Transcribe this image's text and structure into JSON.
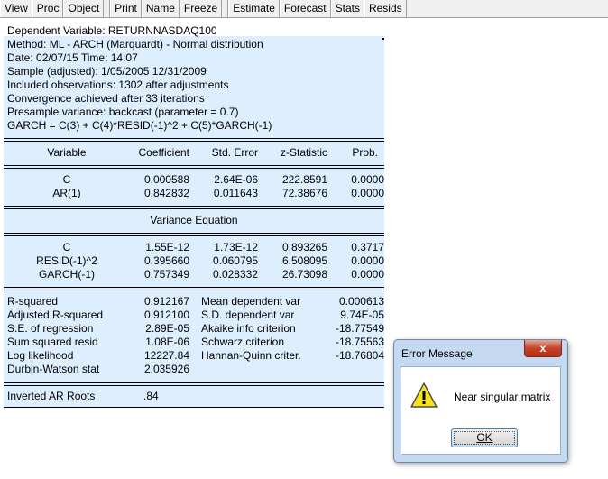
{
  "toolbar": {
    "group1": [
      "View",
      "Proc",
      "Object"
    ],
    "group2": [
      "Print",
      "Name",
      "Freeze"
    ],
    "group3": [
      "Estimate",
      "Forecast",
      "Stats",
      "Resids"
    ]
  },
  "header": [
    "Dependent Variable: RETURNNASDAQ100",
    "Method: ML - ARCH (Marquardt) - Normal distribution",
    "Date: 02/07/15   Time: 14:07",
    "Sample (adjusted): 1/05/2005 12/31/2009",
    "Included observations: 1302 after adjustments",
    "Convergence achieved after 33 iterations",
    "Presample variance: backcast (parameter = 0.7)",
    "GARCH = C(3) + C(4)*RESID(-1)^2 + C(5)*GARCH(-1)"
  ],
  "columns": [
    "Variable",
    "Coefficient",
    "Std. Error",
    "z-Statistic",
    "Prob."
  ],
  "mean_rows": [
    [
      "C",
      "0.000588",
      "2.64E-06",
      "222.8591",
      "0.0000"
    ],
    [
      "AR(1)",
      "0.842832",
      "0.011643",
      "72.38676",
      "0.0000"
    ]
  ],
  "variance_title": "Variance Equation",
  "variance_rows": [
    [
      "C",
      "1.55E-12",
      "1.73E-12",
      "0.893265",
      "0.3717"
    ],
    [
      "RESID(-1)^2",
      "0.395660",
      "0.060795",
      "6.508095",
      "0.0000"
    ],
    [
      "GARCH(-1)",
      "0.757349",
      "0.028332",
      "26.73098",
      "0.0000"
    ]
  ],
  "stats_rows": [
    [
      "R-squared",
      "0.912167",
      "Mean dependent var",
      "0.000613"
    ],
    [
      "Adjusted R-squared",
      "0.912100",
      "S.D. dependent var",
      "9.74E-05"
    ],
    [
      "S.E. of regression",
      "2.89E-05",
      "Akaike info criterion",
      "-18.77549"
    ],
    [
      "Sum squared resid",
      "1.08E-06",
      "Schwarz criterion",
      "-18.75563"
    ],
    [
      "Log likelihood",
      "12227.84",
      "Hannan-Quinn criter.",
      "-18.76804"
    ],
    [
      "Durbin-Watson stat",
      "2.035926",
      "",
      ""
    ]
  ],
  "roots": {
    "label": "Inverted AR Roots",
    "value": ".84"
  },
  "dialog": {
    "title": "Error Message",
    "close_glyph": "x",
    "message": "Near singular matrix",
    "ok_label": "OK",
    "icon": "warning-icon"
  }
}
